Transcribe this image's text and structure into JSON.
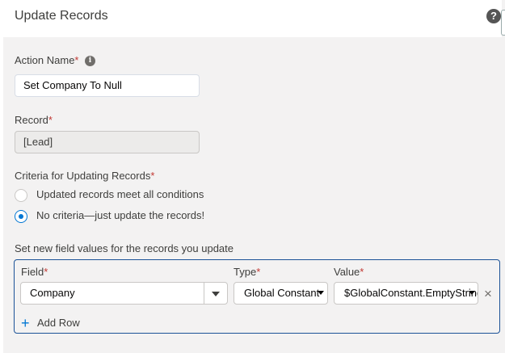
{
  "header": {
    "title": "Update Records",
    "help_icon": "?"
  },
  "action_name": {
    "label": "Action Name",
    "required": "*",
    "info_icon": "i",
    "value": "Set Company To Null"
  },
  "record": {
    "label": "Record",
    "required": "*",
    "value": "[Lead]"
  },
  "criteria": {
    "label": "Criteria for Updating Records",
    "required": "*",
    "options": [
      {
        "label": "Updated records meet all conditions",
        "checked": false
      },
      {
        "label": "No criteria—just update the records!",
        "checked": true
      }
    ]
  },
  "field_values": {
    "label": "Set new field values for the records you update",
    "columns": {
      "field": "Field",
      "type": "Type",
      "value": "Value",
      "required": "*"
    },
    "rows": [
      {
        "field": "Company",
        "type": "Global Constant",
        "value": "$GlobalConstant.EmptyString"
      }
    ],
    "add_row_label": "Add Row",
    "remove_icon": "×",
    "add_icon": "+"
  },
  "colors": {
    "accent": "#0176d3",
    "required": "#c23934",
    "border_active": "#1b5297"
  }
}
